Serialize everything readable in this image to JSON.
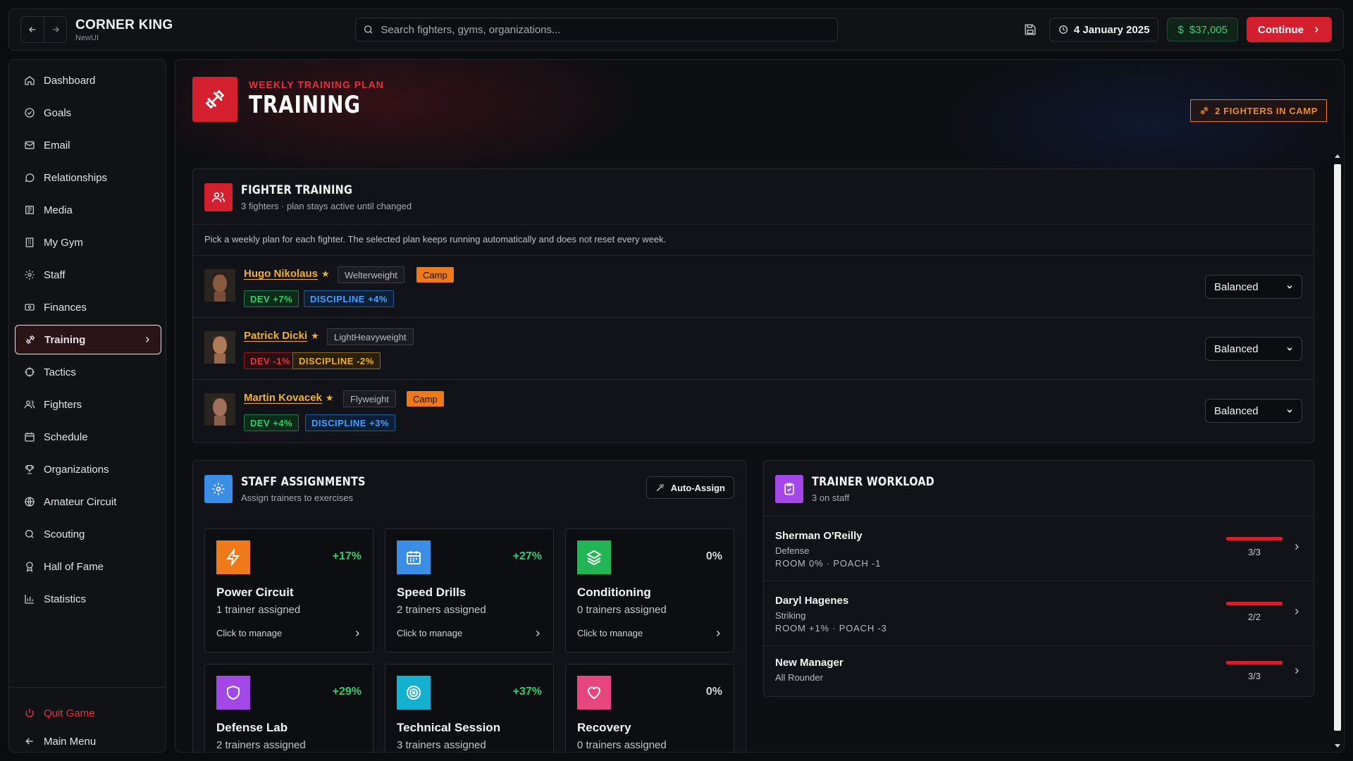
{
  "app": {
    "title": "CORNER KING",
    "subtitle": "NewUI"
  },
  "search": {
    "placeholder": "Search fighters, gyms, organizations..."
  },
  "topbar": {
    "date": "4 January 2025",
    "money": "$37,005",
    "continue_label": "Continue"
  },
  "sidebar": {
    "items": [
      {
        "label": "Dashboard",
        "icon": "home-icon"
      },
      {
        "label": "Goals",
        "icon": "check-circle-icon"
      },
      {
        "label": "Email",
        "icon": "mail-icon"
      },
      {
        "label": "Relationships",
        "icon": "chat-bubble-icon"
      },
      {
        "label": "Media",
        "icon": "newspaper-icon"
      },
      {
        "label": "My Gym",
        "icon": "building-icon"
      },
      {
        "label": "Staff",
        "icon": "gear-icon"
      },
      {
        "label": "Finances",
        "icon": "banknote-icon"
      },
      {
        "label": "Training",
        "icon": "dumbbell-icon",
        "active": true
      },
      {
        "label": "Tactics",
        "icon": "crosshair-icon"
      },
      {
        "label": "Fighters",
        "icon": "users-icon"
      },
      {
        "label": "Schedule",
        "icon": "calendar-icon"
      },
      {
        "label": "Organizations",
        "icon": "trophy-icon"
      },
      {
        "label": "Amateur Circuit",
        "icon": "globe-icon"
      },
      {
        "label": "Scouting",
        "icon": "search-icon"
      },
      {
        "label": "Hall of Fame",
        "icon": "award-icon"
      },
      {
        "label": "Statistics",
        "icon": "bar-chart-icon"
      }
    ],
    "quit_label": "Quit Game",
    "main_menu_label": "Main Menu"
  },
  "header": {
    "kicker": "WEEKLY TRAINING PLAN",
    "title": "TRAINING",
    "camp_badge": "2 FIGHTERS IN CAMP"
  },
  "fighter_training": {
    "title": "FIGHTER TRAINING",
    "subtitle": "3 fighters · plan stays active until changed",
    "description": "Pick a weekly plan for each fighter. The selected plan keeps running automatically and does not reset every week.",
    "fighters": [
      {
        "name": "Hugo Nikolaus",
        "weight_class": "Welterweight",
        "camp": "Camp",
        "dev": "DEV +7%",
        "discipline": "DISCIPLINE +4%",
        "plan": "Balanced"
      },
      {
        "name": "Patrick Dicki",
        "weight_class": "LightHeavyweight",
        "camp": "",
        "dev": "DEV -1%",
        "discipline": "DISCIPLINE -2%",
        "plan": "Balanced"
      },
      {
        "name": "Martin Kovacek",
        "weight_class": "Flyweight",
        "camp": "Camp",
        "dev": "DEV +4%",
        "discipline": "DISCIPLINE +3%",
        "plan": "Balanced"
      }
    ]
  },
  "staff_assignments": {
    "title": "STAFF ASSIGNMENTS",
    "subtitle": "Assign trainers to exercises",
    "auto_assign_label": "Auto-Assign",
    "manage_label": "Click to manage",
    "exercises": [
      {
        "name": "Power Circuit",
        "pct": "+17%",
        "assigned": "1 trainer assigned",
        "color": "#f07a1a",
        "icon": "lightning-icon"
      },
      {
        "name": "Speed Drills",
        "pct": "+27%",
        "assigned": "2 trainers assigned",
        "color": "#3a8ee6",
        "icon": "calendar-grid-icon"
      },
      {
        "name": "Conditioning",
        "pct": "0%",
        "assigned": "0 trainers assigned",
        "color": "#22b455",
        "icon": "layers-icon"
      },
      {
        "name": "Defense Lab",
        "pct": "+29%",
        "assigned": "2 trainers assigned",
        "color": "#a347e6",
        "icon": "shield-icon"
      },
      {
        "name": "Technical Session",
        "pct": "+37%",
        "assigned": "3 trainers assigned",
        "color": "#13b0d0",
        "icon": "target-icon"
      },
      {
        "name": "Recovery",
        "pct": "0%",
        "assigned": "0 trainers assigned",
        "color": "#e6457e",
        "icon": "heart-icon"
      }
    ]
  },
  "trainer_workload": {
    "title": "TRAINER WORKLOAD",
    "subtitle": "3 on staff",
    "trainers": [
      {
        "name": "Sherman O'Reilly",
        "role": "Defense",
        "stats": "ROOM 0% · POACH -1",
        "load": "3/3"
      },
      {
        "name": "Daryl Hagenes",
        "role": "Striking",
        "stats": "ROOM +1% · POACH -3",
        "load": "2/2"
      },
      {
        "name": "New Manager",
        "role": "All Rounder",
        "stats": "",
        "load": "3/3"
      }
    ]
  },
  "colors": {
    "accent": "#d4202e",
    "gold": "#f0b030",
    "camp": "#f07a1a",
    "money": "#3ecf73"
  }
}
